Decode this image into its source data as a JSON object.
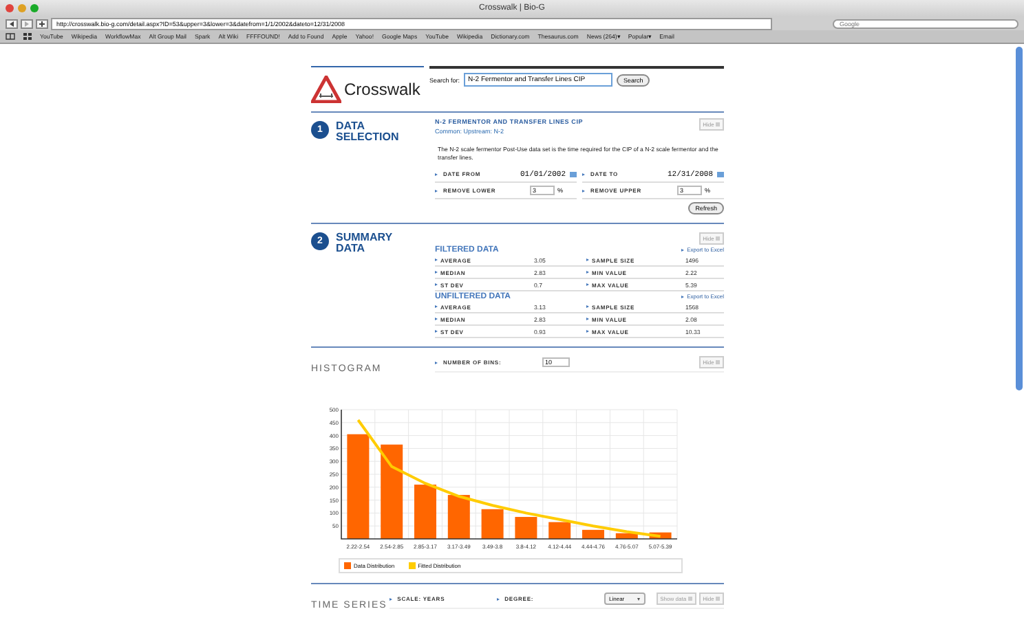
{
  "browser": {
    "title": "Crosswalk | Bio-G",
    "url": "http://crosswalk.bio-g.com/detail.aspx?ID=53&upper=3&lower=3&datefrom=1/1/2002&dateto=12/31/2008",
    "search_placeholder": "Google",
    "bookmarks": [
      "YouTube",
      "Wikipedia",
      "WorkflowMax",
      "Alt Group Mail",
      "Spark",
      "Alt Wiki",
      "FFFFOUND!",
      "Add to Found",
      "Apple",
      "Yahoo!",
      "Google Maps",
      "YouTube",
      "Wikipedia",
      "Dictionary.com",
      "Thesaurus.com",
      "News (264)▾",
      "Popular▾",
      "Email"
    ]
  },
  "header": {
    "logo": "Crosswalk",
    "search_label": "Search for:",
    "search_value": "N-2 Fermentor and Transfer Lines CIP",
    "search_button": "Search"
  },
  "data_selection": {
    "number": "1",
    "title": "DATA SELECTION",
    "dataset_title": "N-2 FERMENTOR AND TRANSFER LINES CIP",
    "subtitle": "Common: Upstream: N-2",
    "hide": "Hide",
    "description": "The N-2 scale fermentor Post-Use data set is the time required for the CIP of a N-2 scale fermentor and the transfer lines.",
    "fields": [
      {
        "label": "DATE FROM",
        "value": "01/01/2002",
        "kind": "date"
      },
      {
        "label": "DATE TO",
        "value": "12/31/2008",
        "kind": "date"
      },
      {
        "label": "REMOVE LOWER",
        "value": "3",
        "unit": "%",
        "kind": "percent"
      },
      {
        "label": "REMOVE UPPER",
        "value": "3",
        "unit": "%",
        "kind": "percent"
      }
    ],
    "refresh": "Refresh"
  },
  "summary": {
    "number": "2",
    "title": "SUMMARY DATA",
    "hide": "Hide",
    "groups": [
      {
        "title": "FILTERED DATA",
        "export": "Export to Excel",
        "rows": [
          {
            "label": "AVERAGE",
            "value": "3.05",
            "label2": "SAMPLE SIZE",
            "value2": "1496"
          },
          {
            "label": "MEDIAN",
            "value": "2.83",
            "label2": "MIN VALUE",
            "value2": "2.22"
          },
          {
            "label": "ST DEV",
            "value": "0.7",
            "label2": "MAX VALUE",
            "value2": "5.39"
          }
        ]
      },
      {
        "title": "UNFILTERED DATA",
        "export": "Export to Excel",
        "rows": [
          {
            "label": "AVERAGE",
            "value": "3.13",
            "label2": "SAMPLE SIZE",
            "value2": "1568"
          },
          {
            "label": "MEDIAN",
            "value": "2.83",
            "label2": "MIN VALUE",
            "value2": "2.08"
          },
          {
            "label": "ST DEV",
            "value": "0.93",
            "label2": "MAX VALUE",
            "value2": "10.33"
          }
        ]
      }
    ]
  },
  "histogram": {
    "title": "HISTOGRAM",
    "bins_label": "NUMBER OF BINS:",
    "bins_value": "10",
    "hide": "Hide",
    "chart_data": {
      "type": "bar",
      "categories": [
        "2.22-2.54",
        "2.54-2.85",
        "2.85-3.17",
        "3.17-3.49",
        "3.49-3.8",
        "3.8-4.12",
        "4.12-4.44",
        "4.44-4.76",
        "4.76-5.07",
        "5.07-5.39"
      ],
      "series": [
        {
          "name": "Data Distribution",
          "type": "bar",
          "color": "#ff6600",
          "values": [
            405,
            365,
            210,
            170,
            115,
            85,
            65,
            35,
            22,
            25
          ]
        },
        {
          "name": "Fitted Distribution",
          "type": "line",
          "color": "#ffcc00",
          "values": [
            460,
            280,
            215,
            165,
            130,
            100,
            75,
            50,
            28,
            10
          ]
        }
      ],
      "grid": true,
      "legend": "bottom",
      "ylim": [
        0,
        500
      ],
      "yticks": [
        50,
        100,
        150,
        200,
        250,
        300,
        350,
        400,
        450,
        500
      ]
    }
  },
  "time_series": {
    "title": "TIME SERIES",
    "scale_label": "SCALE: YEARS",
    "degree_label": "DEGREE:",
    "degree_value": "Linear",
    "show_data": "Show data",
    "hide": "Hide"
  }
}
